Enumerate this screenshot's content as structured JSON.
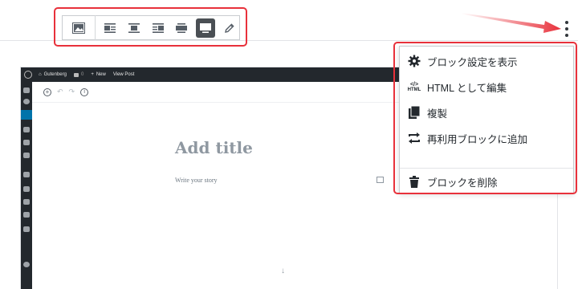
{
  "menu": {
    "items": [
      {
        "label": "ブロック設定を表示",
        "icon": "gear-icon"
      },
      {
        "label": "HTML として編集",
        "icon": "html-icon"
      },
      {
        "label": "複製",
        "icon": "duplicate-icon"
      },
      {
        "label": "再利用ブロックに追加",
        "icon": "reusable-block-icon"
      },
      {
        "label": "ブロックを削除",
        "icon": "trash-icon"
      }
    ],
    "html_icon_label": "HTML"
  },
  "editor": {
    "admin_bar": {
      "site_name": "Gutenberg",
      "comments_count": "0",
      "new_label": "New",
      "view_post_label": "View Post"
    },
    "title_placeholder": "Add title",
    "body_placeholder": "Write your story"
  },
  "colors": {
    "highlight": "#e8313b",
    "active_button": "#4a4f54",
    "admin_bar": "#23282d",
    "admin_accent": "#0073aa"
  }
}
